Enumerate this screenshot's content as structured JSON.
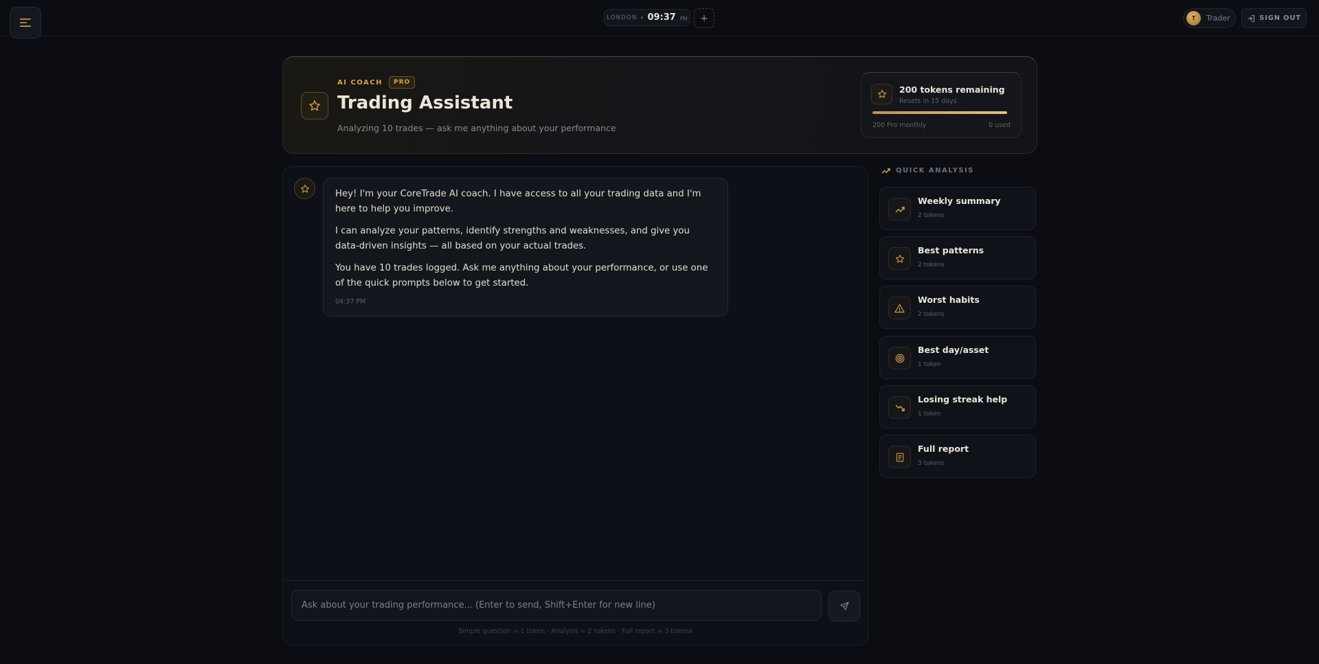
{
  "topbar": {
    "clock": {
      "city": "LONDON",
      "time": "09:37",
      "ampm": "PM"
    },
    "add_clock_label": "+",
    "user": {
      "initial": "T",
      "name": "Trader"
    },
    "signout_label": "SIGN OUT"
  },
  "header": {
    "eyebrow": "AI COACH",
    "badge": "PRO",
    "title": "Trading Assistant",
    "subtitle": "Analyzing 10 trades — ask me anything about your performance",
    "tokens": {
      "title": "200 tokens remaining",
      "reset": "Resets in 15 days",
      "plan": "200 Pro monthly",
      "used": "0 used",
      "remaining_fraction": 1.0
    }
  },
  "chat": {
    "messages": [
      {
        "paragraphs": [
          "Hey! I'm your CoreTrade AI coach. I have access to all your trading data and I'm here to help you improve.",
          "I can analyze your patterns, identify strengths and weaknesses, and give you data-driven insights — all based on your actual trades.",
          "You have 10 trades logged. Ask me anything about your performance, or use one of the quick prompts below to get started."
        ],
        "time": "04:37 PM"
      }
    ],
    "input_placeholder": "Ask about your trading performance... (Enter to send, Shift+Enter for new line)",
    "hint": "Simple question = 1 token · Analysis = 2 tokens · Full report = 3 tokens"
  },
  "quick_analysis": {
    "heading": "QUICK ANALYSIS",
    "items": [
      {
        "title": "Weekly summary",
        "cost": "2 tokens",
        "icon": "trend-up-icon"
      },
      {
        "title": "Best patterns",
        "cost": "2 tokens",
        "icon": "star-icon"
      },
      {
        "title": "Worst habits",
        "cost": "2 tokens",
        "icon": "warning-icon"
      },
      {
        "title": "Best day/asset",
        "cost": "1 token",
        "icon": "target-icon"
      },
      {
        "title": "Losing streak help",
        "cost": "1 token",
        "icon": "trend-down-icon"
      },
      {
        "title": "Full report",
        "cost": "3 tokens",
        "icon": "document-icon"
      }
    ]
  },
  "colors": {
    "accent": "#d7a24d",
    "background": "#0b0d12"
  }
}
